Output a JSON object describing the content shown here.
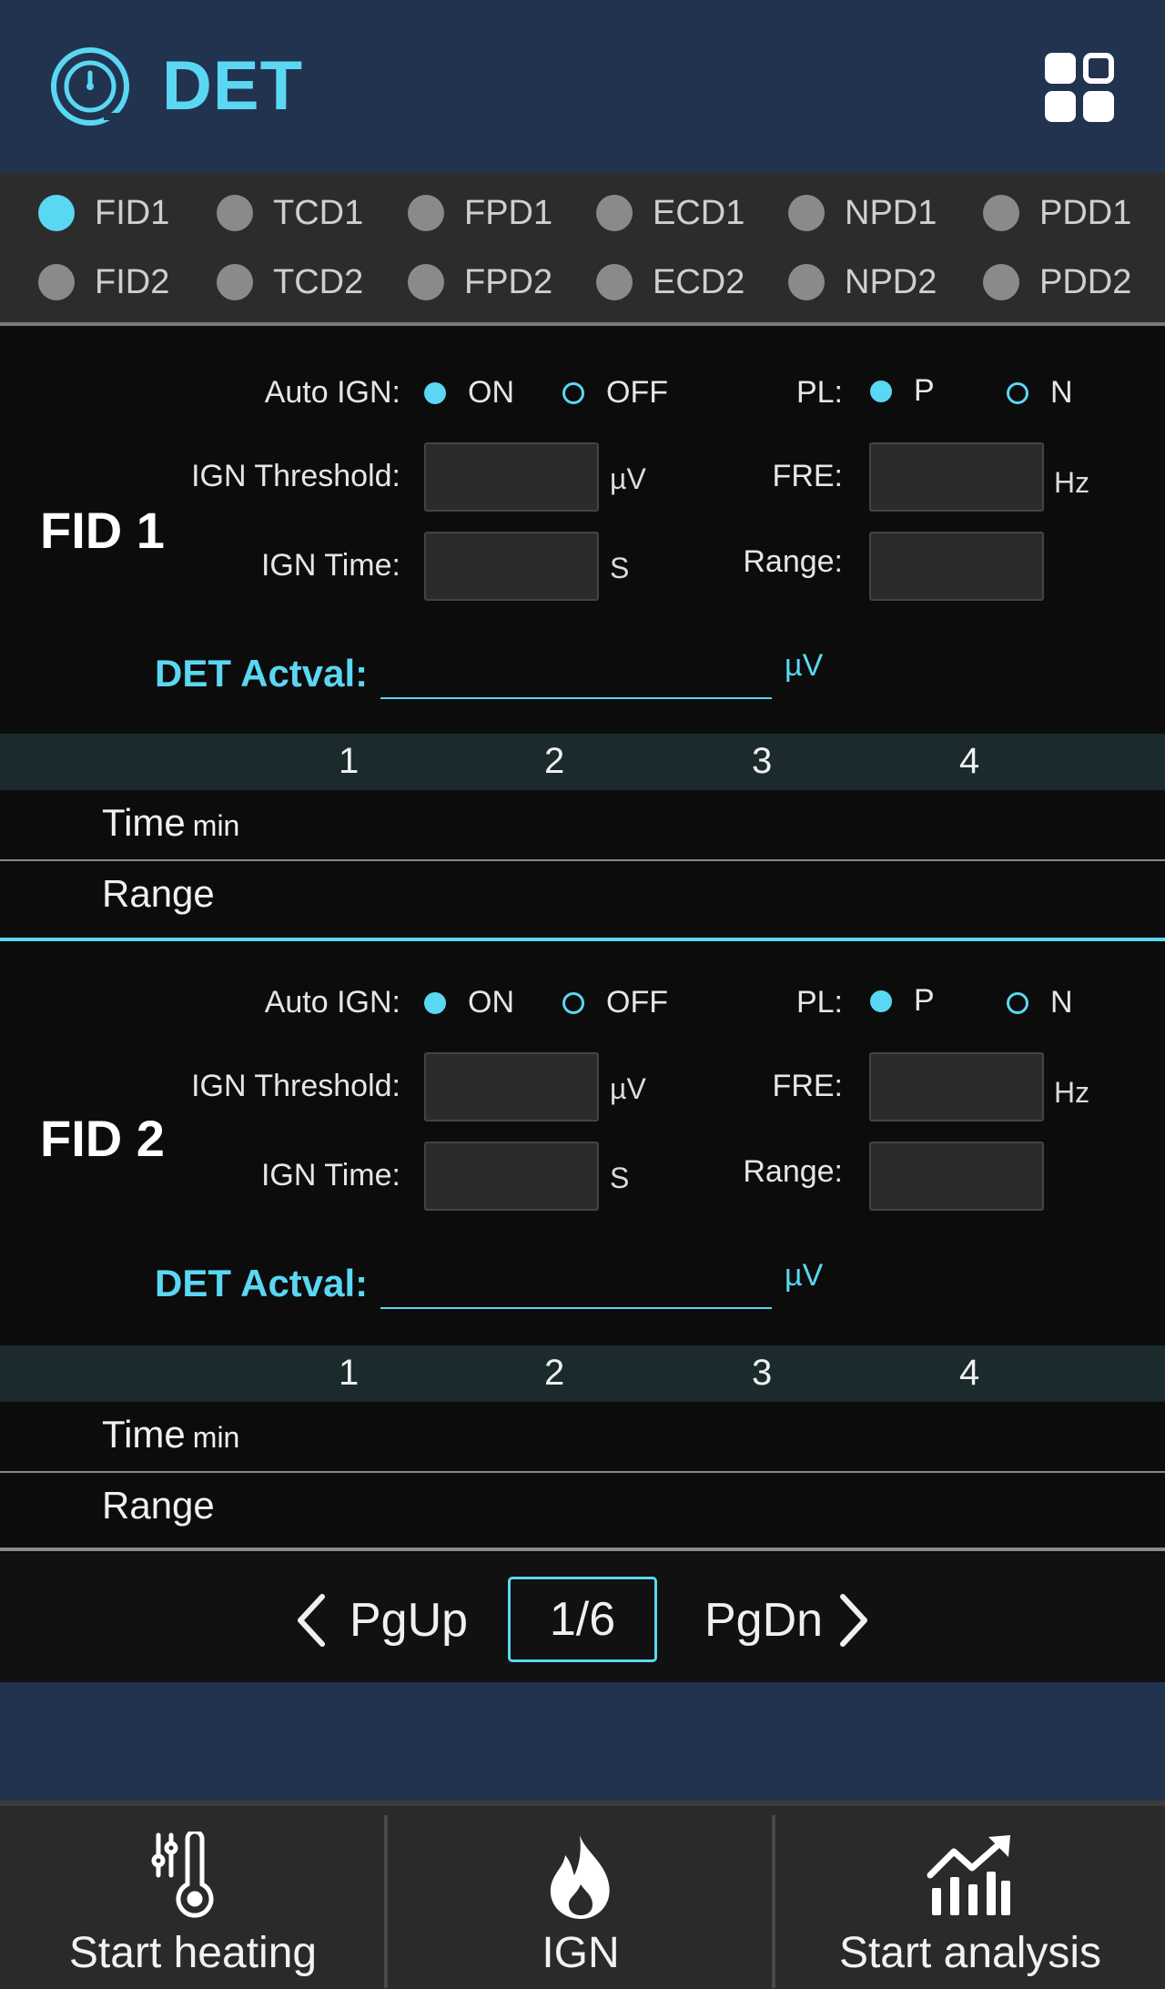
{
  "header": {
    "title": "DET"
  },
  "detectors": {
    "row1": [
      "FID1",
      "TCD1",
      "FPD1",
      "ECD1",
      "NPD1",
      "PDD1"
    ],
    "row2": [
      "FID2",
      "TCD2",
      "FPD2",
      "ECD2",
      "NPD2",
      "PDD2"
    ],
    "selected": "FID1"
  },
  "fid1": {
    "title": "FID 1",
    "auto_ign_label": "Auto IGN:",
    "on_label": "ON",
    "off_label": "OFF",
    "auto_ign_value": "ON",
    "pl_label": "PL:",
    "p_label": "P",
    "n_label": "N",
    "pl_value": "P",
    "ign_threshold_label": "IGN Threshold:",
    "ign_threshold_unit": "µV",
    "ign_threshold_value": "",
    "ign_time_label": "IGN Time:",
    "ign_time_unit": "S",
    "ign_time_value": "",
    "fre_label": "FRE:",
    "fre_unit": "Hz",
    "fre_value": "",
    "range_label": "Range:",
    "range_value": "",
    "actval_label": "DET Actval:",
    "actval_value": "",
    "actval_unit": "µV",
    "table": {
      "columns": [
        "1",
        "2",
        "3",
        "4"
      ],
      "time_label": "Time",
      "time_unit": "min",
      "range_label": "Range"
    }
  },
  "fid2": {
    "title": "FID 2",
    "auto_ign_label": "Auto IGN:",
    "on_label": "ON",
    "off_label": "OFF",
    "auto_ign_value": "ON",
    "pl_label": "PL:",
    "p_label": "P",
    "n_label": "N",
    "pl_value": "P",
    "ign_threshold_label": "IGN Threshold:",
    "ign_threshold_unit": "µV",
    "ign_threshold_value": "",
    "ign_time_label": "IGN Time:",
    "ign_time_unit": "S",
    "ign_time_value": "",
    "fre_label": "FRE:",
    "fre_unit": "Hz",
    "fre_value": "",
    "range_label": "Range:",
    "range_value": "",
    "actval_label": "DET Actval:",
    "actval_value": "",
    "actval_unit": "µV",
    "table": {
      "columns": [
        "1",
        "2",
        "3",
        "4"
      ],
      "time_label": "Time",
      "time_unit": "min",
      "range_label": "Range"
    }
  },
  "pager": {
    "prev_label": "PgUp",
    "page": "1/6",
    "next_label": "PgDn"
  },
  "bottom": {
    "heating_label": "Start heating",
    "heating_icon": "thermometer-sliders-icon",
    "ign_label": "IGN",
    "ign_icon": "flame-icon",
    "analysis_label": "Start analysis",
    "analysis_icon": "chart-trend-icon"
  },
  "colors": {
    "accent": "#5ad7f2",
    "header_bg": "#223350",
    "panel_bg": "#0c0c0c"
  }
}
